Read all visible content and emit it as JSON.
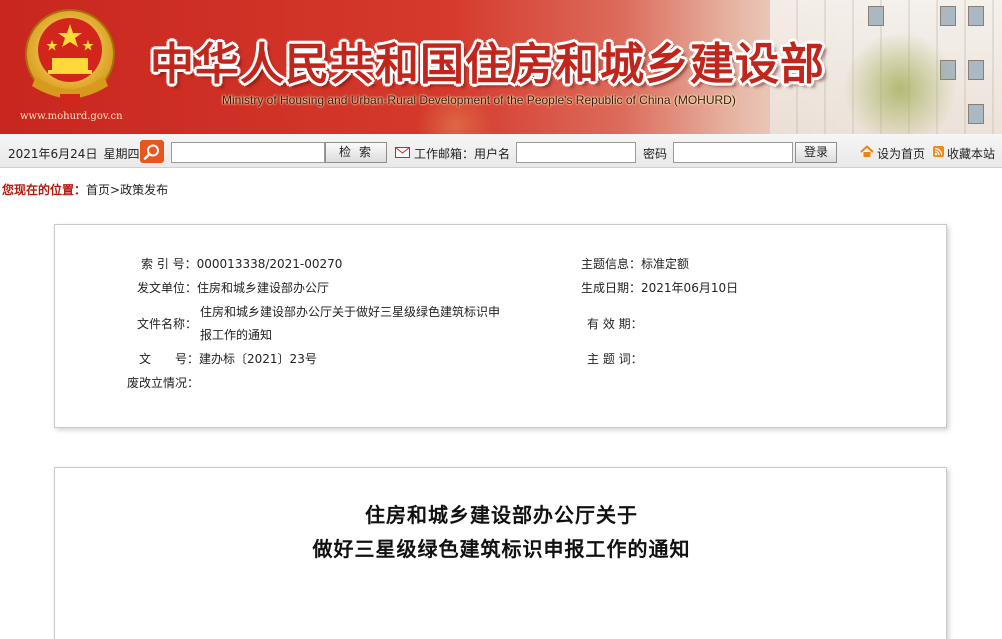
{
  "header": {
    "title_cn": "中华人民共和国住房和城乡建设部",
    "title_en": "Ministry of Housing and Urban-Rural Development of the People's Republic of China (MOHURD)",
    "site_url": "www.mohurd.gov.cn"
  },
  "toolbar": {
    "date": "2021年6月24日",
    "weekday": "星期四",
    "search_value": "",
    "search_label": "检索",
    "mail_label": "工作邮箱：用户名",
    "username_value": "",
    "password_label": "密码",
    "password_value": "",
    "login_label": "登录",
    "set_home_label": "设为首页",
    "bookmark_label": "收藏本站"
  },
  "breadcrumb": {
    "lead": "您现在的位置：",
    "home": "首页",
    "sep": ">",
    "current": "政策发布"
  },
  "info": {
    "index_no_label": "索 引 号：",
    "index_no": "000013338/2021-00270",
    "issuer_label": "发文单位：",
    "issuer": "住房和城乡建设部办公厅",
    "doc_name_label": "文件名称：",
    "doc_name_line1": "住房和城乡建设部办公厅关于做好三星级绿色建筑标识申",
    "doc_name_line2": "报工作的通知",
    "doc_no_label": "文　　号：",
    "doc_no": "建办标〔2021〕23号",
    "status_label": "废改立情况：",
    "status": "",
    "topic_label": "主题信息：",
    "topic": "标准定额",
    "date_label": "生成日期：",
    "date": "2021年06月10日",
    "validity_label": "有 效 期：",
    "validity": "",
    "keywords_label": "主 题 词：",
    "keywords": ""
  },
  "document": {
    "title_line1": "住房和城乡建设部办公厅关于",
    "title_line2": "做好三星级绿色建筑标识申报工作的通知"
  },
  "colors": {
    "banner_red": "#c8261e",
    "title_red": "#c0261c",
    "breadcrumb_red": "#b31b12",
    "search_orange": "#e6571e"
  }
}
